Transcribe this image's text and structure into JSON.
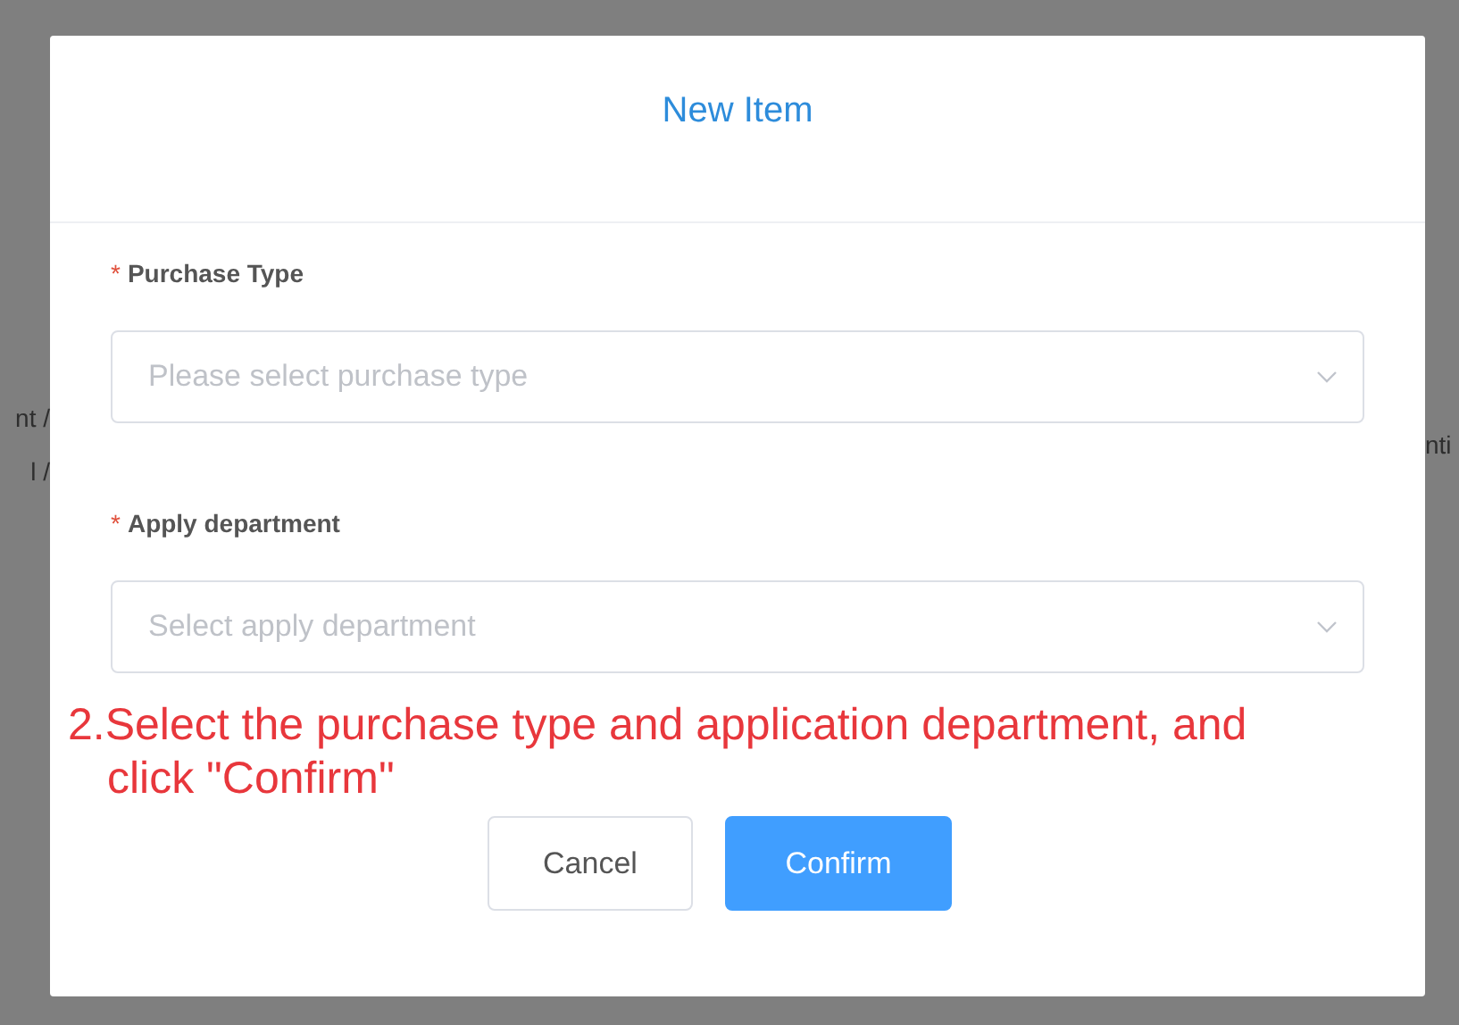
{
  "background": {
    "left_cell": [
      "nt /",
      "l /"
    ],
    "right_cell": "nti"
  },
  "dialog": {
    "title": "New Item",
    "fields": [
      {
        "mark": "*",
        "label": "Purchase Type",
        "placeholder": "Please select purchase type"
      },
      {
        "mark": "*",
        "label": "Apply department",
        "placeholder": "Select apply department"
      }
    ],
    "annotation": "2.Select the purchase type and application department, and click \"Confirm\"",
    "buttons": [
      {
        "label": "Cancel",
        "kind": "default"
      },
      {
        "label": "Confirm",
        "kind": "primary"
      }
    ]
  }
}
